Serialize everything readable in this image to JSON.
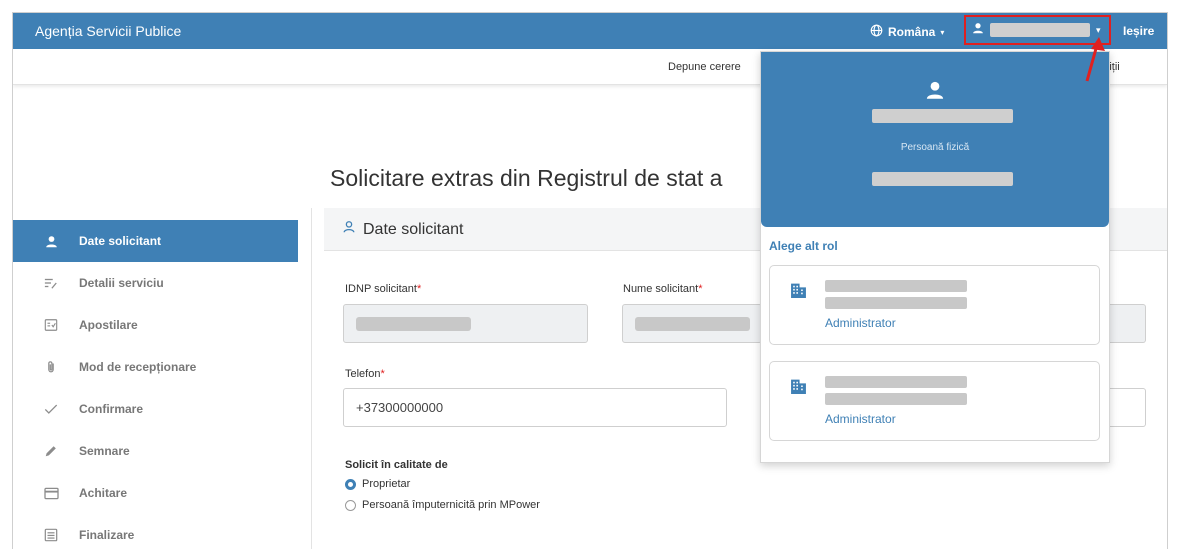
{
  "topbar": {
    "brand": "Agenția Servicii Publice",
    "language": "Româna",
    "logout": "Ieșire"
  },
  "subnav": {
    "item1": "Depune cerere",
    "item2": "ondiții"
  },
  "page": {
    "title": "Solicitare extras din Registrul de stat a"
  },
  "steps": [
    {
      "label": "Date solicitant",
      "icon": "person-icon"
    },
    {
      "label": "Detalii serviciu",
      "icon": "list-edit-icon"
    },
    {
      "label": "Apostilare",
      "icon": "document-check-icon"
    },
    {
      "label": "Mod de recepționare",
      "icon": "paperclip-icon"
    },
    {
      "label": "Confirmare",
      "icon": "checkmark-icon"
    },
    {
      "label": "Semnare",
      "icon": "pen-icon"
    },
    {
      "label": "Achitare",
      "icon": "card-icon"
    },
    {
      "label": "Finalizare",
      "icon": "list-icon"
    }
  ],
  "section": {
    "title": "Date solicitant"
  },
  "form": {
    "idnp_label": "IDNP solicitant",
    "name_label": "Nume solicitant",
    "required_mark": "*",
    "phone_label": "Telefon",
    "phone_value": "+37300000000",
    "capacity_label": "Solicit în calitate de",
    "radio_owner": "Proprietar",
    "radio_proxy": "Persoană împuternicită prin MPower",
    "selected_radio": "Proprietar"
  },
  "dropdown": {
    "role": "Persoană fizică",
    "alt_role_label": "Alege alt rol",
    "organizations": [
      {
        "role": "Administrator"
      },
      {
        "role": "Administrator"
      }
    ]
  },
  "colors": {
    "primary": "#3f80b5",
    "highlight": "#e02020"
  }
}
